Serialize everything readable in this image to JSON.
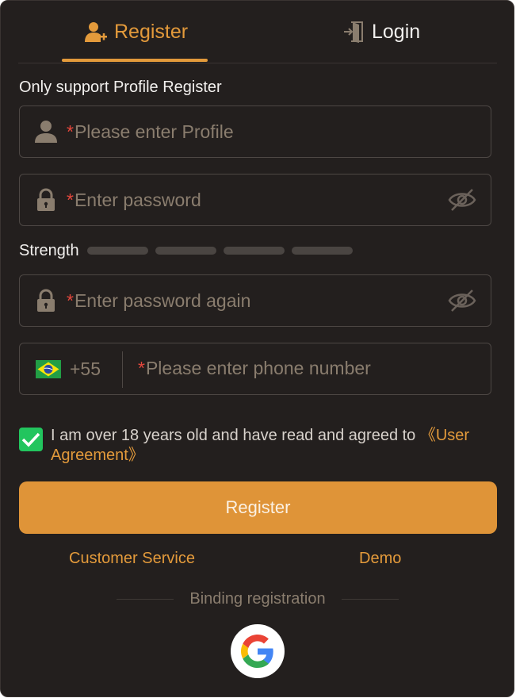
{
  "tabs": {
    "register_label": "Register",
    "login_label": "Login"
  },
  "form": {
    "hint": "Only support Profile Register",
    "required_mark": "*",
    "profile_placeholder": "Please enter Profile",
    "password_placeholder": "Enter password",
    "strength_label": "Strength",
    "password_again_placeholder": "Enter password again",
    "phone_code": "+55",
    "phone_placeholder": "Please enter phone number"
  },
  "agreement": {
    "checked": true,
    "text": "I am over 18 years old and have read and agreed to ",
    "link": "《User Agreement》"
  },
  "actions": {
    "register_label": "Register",
    "customer_service": "Customer Service",
    "demo": "Demo",
    "binding_label": "Binding registration"
  },
  "icons": {
    "register_tab": "user-plus-icon",
    "login_tab": "login-door-icon",
    "profile": "user-icon",
    "password": "lock-icon",
    "eye": "eye-off-icon",
    "flag": "brazil-flag-icon",
    "check": "check-icon",
    "google": "google-icon"
  },
  "colors": {
    "accent": "#e39a3b",
    "background": "#231f1e",
    "required": "#e4473c",
    "checkbox": "#22c55e"
  }
}
